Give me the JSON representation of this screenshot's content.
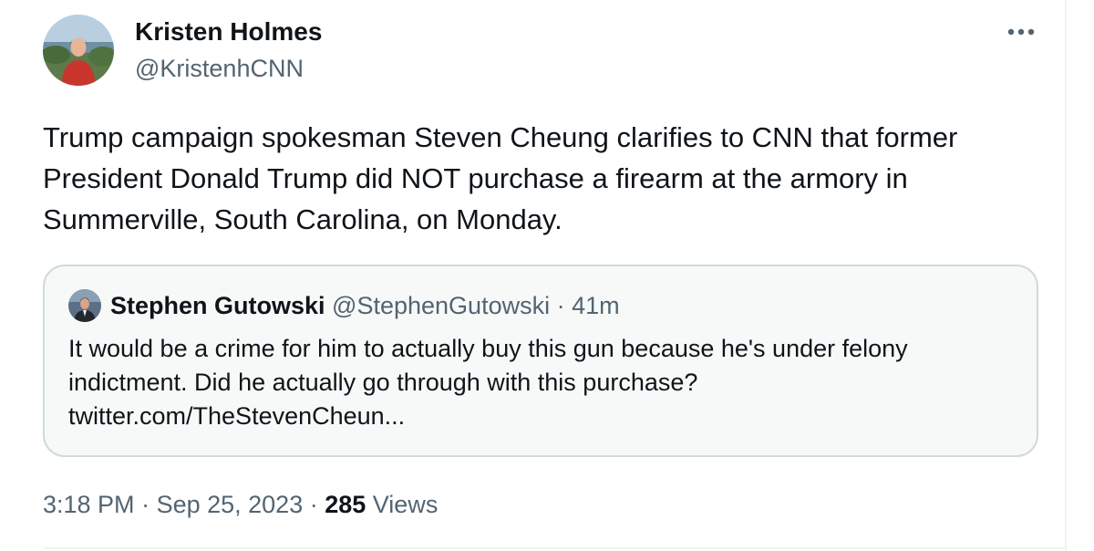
{
  "tweet": {
    "author": {
      "name": "Kristen Holmes",
      "handle": "@KristenhCNN"
    },
    "more_icon": "more-horizontal-icon",
    "text_lines": [
      "Trump campaign spokesman Steven Cheung clarifies to CNN that former",
      "President Donald Trump did NOT purchase a firearm at the armory in",
      "Summerville, South Carolina, on Monday."
    ],
    "quote": {
      "author_name": "Stephen Gutowski",
      "author_handle": "@StephenGutowski",
      "separator": " · ",
      "age": "41m",
      "text_lines": [
        "It would be a crime for him to actually buy this gun because he's under felony",
        "indictment. Did he actually go through with this purchase?",
        "twitter.com/TheStevenCheun..."
      ]
    },
    "meta": {
      "time": "3:18 PM",
      "sep1": " · ",
      "date": "Sep 25, 2023",
      "sep2": " · ",
      "views_count": "285",
      "views_label": " Views"
    }
  },
  "colors": {
    "text_primary": "#0f1419",
    "text_secondary": "#536471",
    "quote_border": "#cfd9de",
    "quote_background": "#f7f9f9"
  }
}
